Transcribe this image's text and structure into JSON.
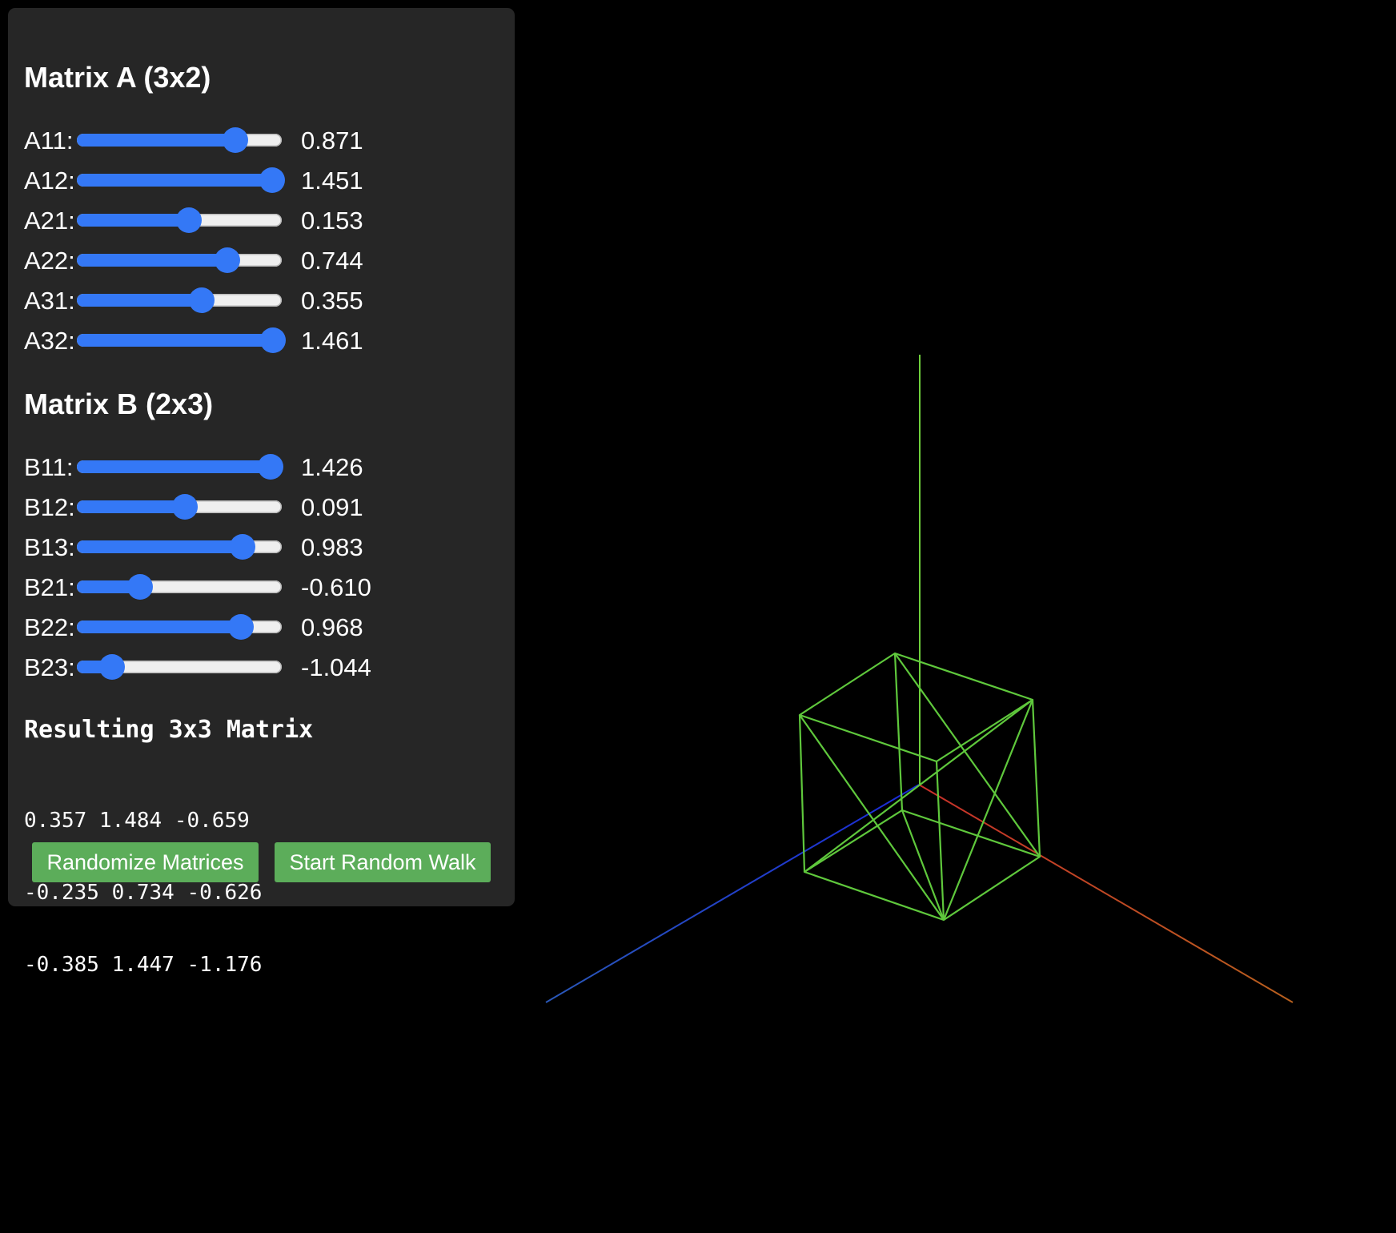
{
  "matrix_a": {
    "title": "Matrix A (3x2)",
    "sliders": [
      {
        "label": "A11:",
        "value": 0.871,
        "display": "0.871"
      },
      {
        "label": "A12:",
        "value": 1.451,
        "display": "1.451"
      },
      {
        "label": "A21:",
        "value": 0.153,
        "display": "0.153"
      },
      {
        "label": "A22:",
        "value": 0.744,
        "display": "0.744"
      },
      {
        "label": "A31:",
        "value": 0.355,
        "display": "0.355"
      },
      {
        "label": "A32:",
        "value": 1.461,
        "display": "1.461"
      }
    ]
  },
  "matrix_b": {
    "title": "Matrix B (2x3)",
    "sliders": [
      {
        "label": "B11:",
        "value": 1.426,
        "display": "1.426"
      },
      {
        "label": "B12:",
        "value": 0.091,
        "display": "0.091"
      },
      {
        "label": "B13:",
        "value": 0.983,
        "display": "0.983"
      },
      {
        "label": "B21:",
        "value": -0.61,
        "display": "-0.610"
      },
      {
        "label": "B22:",
        "value": 0.968,
        "display": "0.968"
      },
      {
        "label": "B23:",
        "value": -1.044,
        "display": "-1.044"
      }
    ]
  },
  "result": {
    "title": "Resulting 3x3 Matrix",
    "rows": [
      "0.357 1.484 -0.659",
      "-0.235 0.734 -0.626",
      "-0.385 1.447 -1.176"
    ]
  },
  "buttons": {
    "randomize_label": "Randomize Matrices",
    "random_walk_label": "Start Random Walk"
  },
  "colors": {
    "panel_bg": "#262626",
    "slider_accent": "#3478f6",
    "button_green": "#5cad5a",
    "wireframe_green": "#5fc83c",
    "axis_x": "#c8402a",
    "axis_y": "#6fcf3c",
    "axis_z": "#1f3fc8"
  }
}
